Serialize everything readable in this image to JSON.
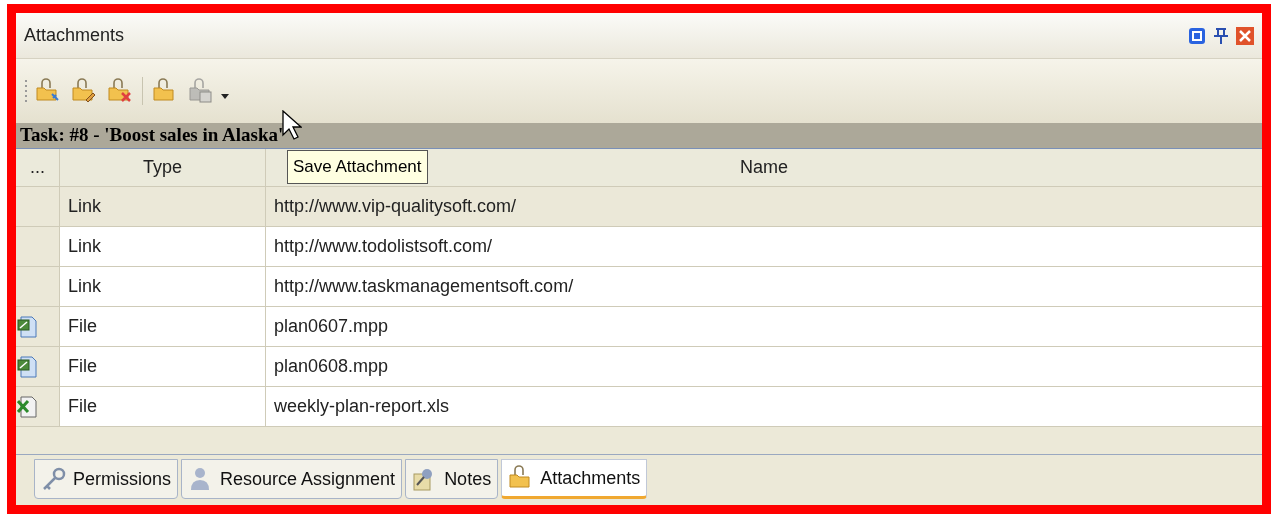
{
  "window": {
    "title": "Attachments"
  },
  "toolbar": [
    {
      "kind": "add",
      "disabled": false
    },
    {
      "kind": "edit",
      "disabled": false
    },
    {
      "kind": "delete",
      "disabled": false
    },
    {
      "kind": "separator"
    },
    {
      "kind": "open",
      "disabled": false
    },
    {
      "kind": "save",
      "disabled": true
    }
  ],
  "tooltip": "Save Attachment",
  "task_header": "Task: #8 - 'Boost sales in Alaska'",
  "table": {
    "columns": [
      "...",
      "Type",
      "Name"
    ],
    "rows": [
      {
        "kind": "link",
        "type": "Link",
        "name": "http://www.vip-qualitysoft.com/",
        "selected": true
      },
      {
        "kind": "link",
        "type": "Link",
        "name": "http://www.todolistsoft.com/",
        "selected": false
      },
      {
        "kind": "link",
        "type": "Link",
        "name": "http://www.taskmanagementsoft.com/",
        "selected": false
      },
      {
        "kind": "project",
        "type": "File",
        "name": "plan0607.mpp",
        "selected": false
      },
      {
        "kind": "project",
        "type": "File",
        "name": "plan0608.mpp",
        "selected": false
      },
      {
        "kind": "spreadsheet",
        "type": "File",
        "name": "weekly-plan-report.xls",
        "selected": false
      }
    ]
  },
  "tabs": [
    {
      "label": "Permissions",
      "selected": false
    },
    {
      "label": "Resource Assignment",
      "selected": false
    },
    {
      "label": "Notes",
      "selected": false
    },
    {
      "label": "Attachments",
      "selected": true
    }
  ]
}
